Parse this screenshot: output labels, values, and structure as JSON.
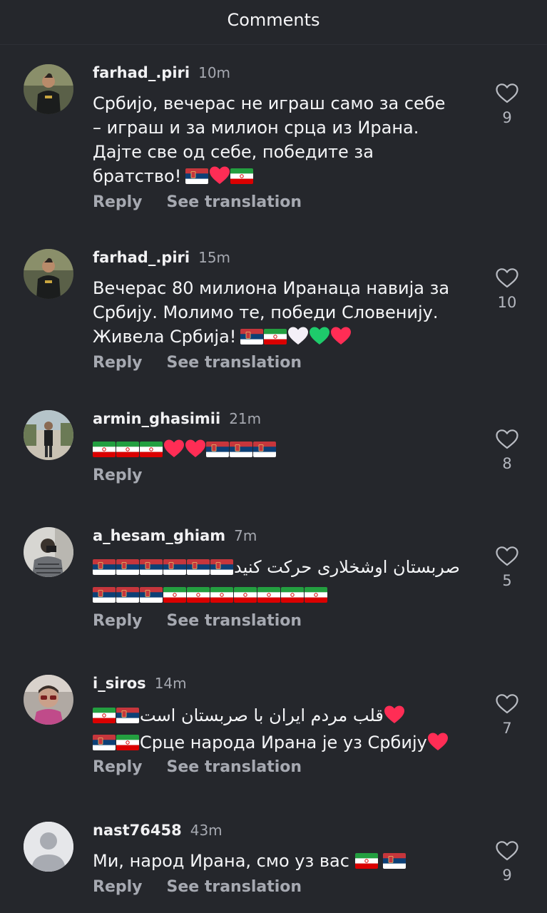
{
  "header": {
    "title": "Comments"
  },
  "actions": {
    "reply": "Reply",
    "see_translation": "See translation"
  },
  "colors": {
    "background": "#25272c",
    "heart_red": "#ff2d55",
    "heart_green": "#1ecb6b",
    "heart_white": "#f4f0f7"
  },
  "comments": [
    {
      "username": "farhad_.piri",
      "time": "10m",
      "lines": [
        "Србијо, вечерас не играш само за себе",
        "– играш и за милион срца из Ирана.",
        "Дајте све од себе, победите за",
        "братство!"
      ],
      "emoji_suffix": [
        "serbia-flag",
        "red-heart",
        "iran-flag"
      ],
      "likes": "9",
      "avatar_icon": "profile-photo-man-icon"
    },
    {
      "username": "farhad_.piri",
      "time": "15m",
      "lines": [
        "Вечерас 80 милиона Иранаца навија за",
        "Србију. Молимо те, победи Словенију.",
        "Живела Србија!"
      ],
      "emoji_suffix": [
        "serbia-flag",
        "iran-flag",
        "white-heart",
        "green-heart",
        "red-heart"
      ],
      "likes": "10",
      "avatar_icon": "profile-photo-man-icon"
    },
    {
      "username": "armin_ghasimii",
      "time": "21m",
      "emoji_line": [
        "iran-flag",
        "iran-flag",
        "iran-flag",
        "red-heart",
        "red-heart",
        "serbia-flag",
        "serbia-flag",
        "serbia-flag"
      ],
      "likes": "8",
      "avatar_icon": "profile-photo-outdoor-icon"
    },
    {
      "username": "a_hesam_ghiam",
      "time": "7m",
      "rtl_text": "صربستان اوشخلارى حركت كنيد",
      "line1_flags": [
        "serbia-flag",
        "serbia-flag",
        "serbia-flag",
        "serbia-flag",
        "serbia-flag",
        "serbia-flag"
      ],
      "line2_flags": [
        "serbia-flag",
        "serbia-flag",
        "serbia-flag",
        "iran-flag",
        "iran-flag",
        "iran-flag",
        "iran-flag",
        "iran-flag",
        "iran-flag",
        "iran-flag"
      ],
      "likes": "5",
      "avatar_icon": "profile-photo-mirror-selfie-icon"
    },
    {
      "username": "i_siros",
      "time": "14m",
      "rtl_text": "قلب مردم ایران با صربستان است",
      "line2_text": "Срце народа Ирана је уз Србију",
      "likes": "7",
      "avatar_icon": "profile-photo-sunglasses-icon"
    },
    {
      "username": "nast76458",
      "time": "43m",
      "text": "Ми, народ Ирана, смо уз вас",
      "likes": "9",
      "avatar_icon": "default-avatar-icon"
    }
  ]
}
